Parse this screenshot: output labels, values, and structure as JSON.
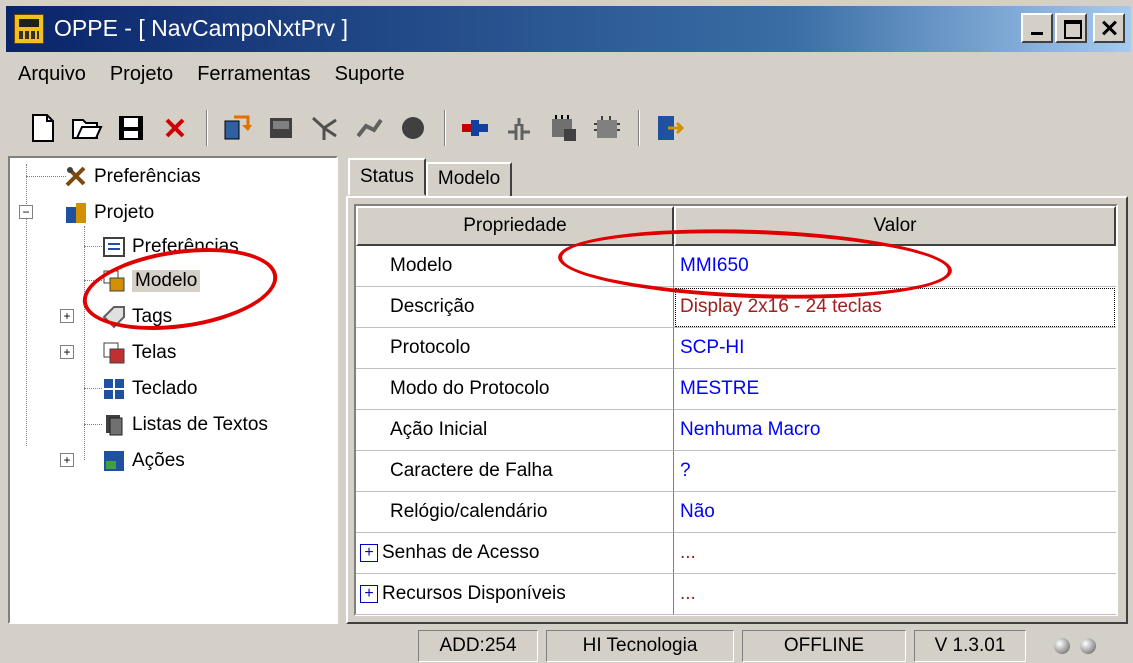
{
  "window": {
    "title": "OPPE - [ NavCampoNxtPrv ]"
  },
  "menu": [
    "Arquivo",
    "Projeto",
    "Ferramentas",
    "Suporte"
  ],
  "toolbar": {
    "icons": [
      "new-file-icon",
      "open-folder-icon",
      "save-icon",
      "delete-icon",
      "transfer-icon",
      "device-icon",
      "network-icon",
      "connect-icon",
      "record-icon",
      "plug-icon",
      "disconnect-icon",
      "memory-icon",
      "chip-icon",
      "exit-icon"
    ]
  },
  "tree": {
    "items": [
      {
        "label": "Preferências",
        "icon": "tools-icon"
      },
      {
        "label": "Projeto",
        "icon": "project-icon"
      },
      {
        "label": "Preferências",
        "icon": "preferences-icon"
      },
      {
        "label": "Modelo",
        "icon": "model-icon"
      },
      {
        "label": "Tags",
        "icon": "tags-icon"
      },
      {
        "label": "Telas",
        "icon": "screens-icon"
      },
      {
        "label": "Teclado",
        "icon": "keyboard-icon"
      },
      {
        "label": "Listas de Textos",
        "icon": "text-list-icon"
      },
      {
        "label": "Ações",
        "icon": "actions-icon"
      }
    ]
  },
  "tabs": [
    "Status",
    "Modelo"
  ],
  "grid": {
    "headers": [
      "Propriedade",
      "Valor"
    ],
    "rows": [
      {
        "prop": "Modelo",
        "value": "MMI650"
      },
      {
        "prop": "Descrição",
        "value": "Display 2x16 - 24 teclas"
      },
      {
        "prop": "Protocolo",
        "value": "SCP-HI"
      },
      {
        "prop": "Modo do Protocolo",
        "value": "MESTRE"
      },
      {
        "prop": "Ação Inicial",
        "value": "Nenhuma Macro"
      },
      {
        "prop": "Caractere de Falha",
        "value": "?"
      },
      {
        "prop": "Relógio/calendário",
        "value": "Não"
      },
      {
        "prop": "Senhas de Acesso",
        "value": "..."
      },
      {
        "prop": "Recursos Disponíveis",
        "value": "..."
      }
    ]
  },
  "status": {
    "address": "ADD:254",
    "company": "HI Tecnologia",
    "mode": "OFFLINE",
    "version": "V 1.3.01"
  },
  "colors": {
    "annotation": "#e00000",
    "value_text": "#0000ff",
    "title_bar": "#0a246a"
  }
}
